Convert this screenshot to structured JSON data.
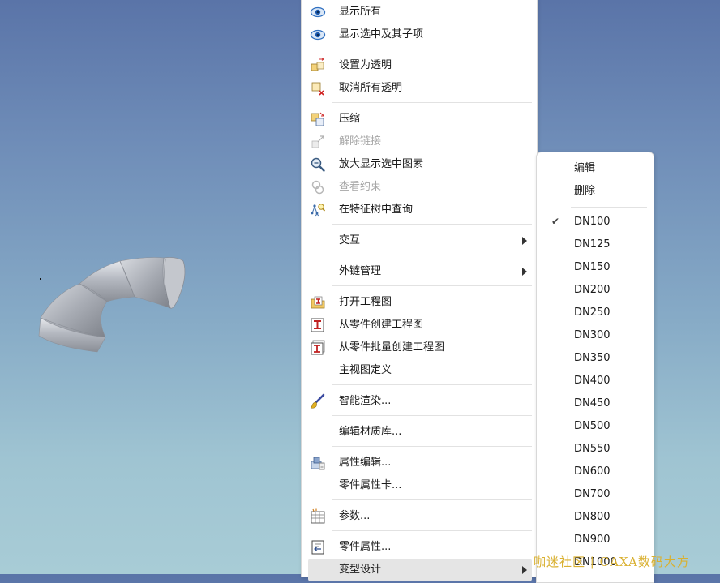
{
  "main_menu": {
    "items": [
      {
        "label": "显示所有",
        "icon": "eye-icon",
        "disabled": false
      },
      {
        "label": "显示选中及其子项",
        "icon": "eye-icon",
        "disabled": false
      },
      {
        "label": "设置为透明",
        "icon": "set-transparent-icon",
        "disabled": false
      },
      {
        "label": "取消所有透明",
        "icon": "cancel-transparent-icon",
        "disabled": false
      },
      {
        "label": "压缩",
        "icon": "compress-icon",
        "disabled": false
      },
      {
        "label": "解除链接",
        "icon": "unlink-icon",
        "disabled": true
      },
      {
        "label": "放大显示选中图素",
        "icon": "zoom-icon",
        "disabled": false
      },
      {
        "label": "查看约束",
        "icon": "constraint-icon",
        "disabled": true
      },
      {
        "label": "在特征树中查询",
        "icon": "feature-tree-query-icon",
        "disabled": false
      },
      {
        "label": "交互",
        "icon": "",
        "disabled": false,
        "submenu": true
      },
      {
        "label": "外链管理",
        "icon": "",
        "disabled": false,
        "submenu": true
      },
      {
        "label": "打开工程图",
        "icon": "open-drawing-icon",
        "disabled": false
      },
      {
        "label": "从零件创建工程图",
        "icon": "create-drawing-icon",
        "disabled": false
      },
      {
        "label": "从零件批量创建工程图",
        "icon": "batch-drawing-icon",
        "disabled": false
      },
      {
        "label": "主视图定义",
        "icon": "",
        "disabled": false
      },
      {
        "label": "智能渲染...",
        "icon": "render-brush-icon",
        "disabled": false
      },
      {
        "label": "编辑材质库...",
        "icon": "",
        "disabled": false
      },
      {
        "label": "属性编辑...",
        "icon": "property-edit-icon",
        "disabled": false
      },
      {
        "label": "零件属性卡...",
        "icon": "",
        "disabled": false
      },
      {
        "label": "参数...",
        "icon": "parameters-icon",
        "disabled": false
      },
      {
        "label": "零件属性...",
        "icon": "part-properties-icon",
        "disabled": false
      },
      {
        "label": "变型设计",
        "icon": "",
        "disabled": false,
        "submenu": true,
        "highlighted": true
      }
    ]
  },
  "sub_menu": {
    "actions": [
      {
        "label": "编辑"
      },
      {
        "label": "删除"
      }
    ],
    "variants": [
      {
        "label": "DN100",
        "checked": true
      },
      {
        "label": "DN125",
        "checked": false
      },
      {
        "label": "DN150",
        "checked": false
      },
      {
        "label": "DN200",
        "checked": false
      },
      {
        "label": "DN250",
        "checked": false
      },
      {
        "label": "DN300",
        "checked": false
      },
      {
        "label": "DN350",
        "checked": false
      },
      {
        "label": "DN400",
        "checked": false
      },
      {
        "label": "DN450",
        "checked": false
      },
      {
        "label": "DN500",
        "checked": false
      },
      {
        "label": "DN550",
        "checked": false
      },
      {
        "label": "DN600",
        "checked": false
      },
      {
        "label": "DN700",
        "checked": false
      },
      {
        "label": "DN800",
        "checked": false
      },
      {
        "label": "DN900",
        "checked": false
      },
      {
        "label": "DN1000",
        "checked": false
      }
    ],
    "check_glyph": "✔"
  },
  "watermark": "咖迷社区 | CAXA数码大方",
  "colors": {
    "background_top": "#5a74a8",
    "background_bottom": "#a8ccd6",
    "menu_bg": "#ffffff",
    "hover_bg": "#e5e5e5",
    "disabled_text": "#a6a6a6",
    "watermark": "#d9b030"
  }
}
